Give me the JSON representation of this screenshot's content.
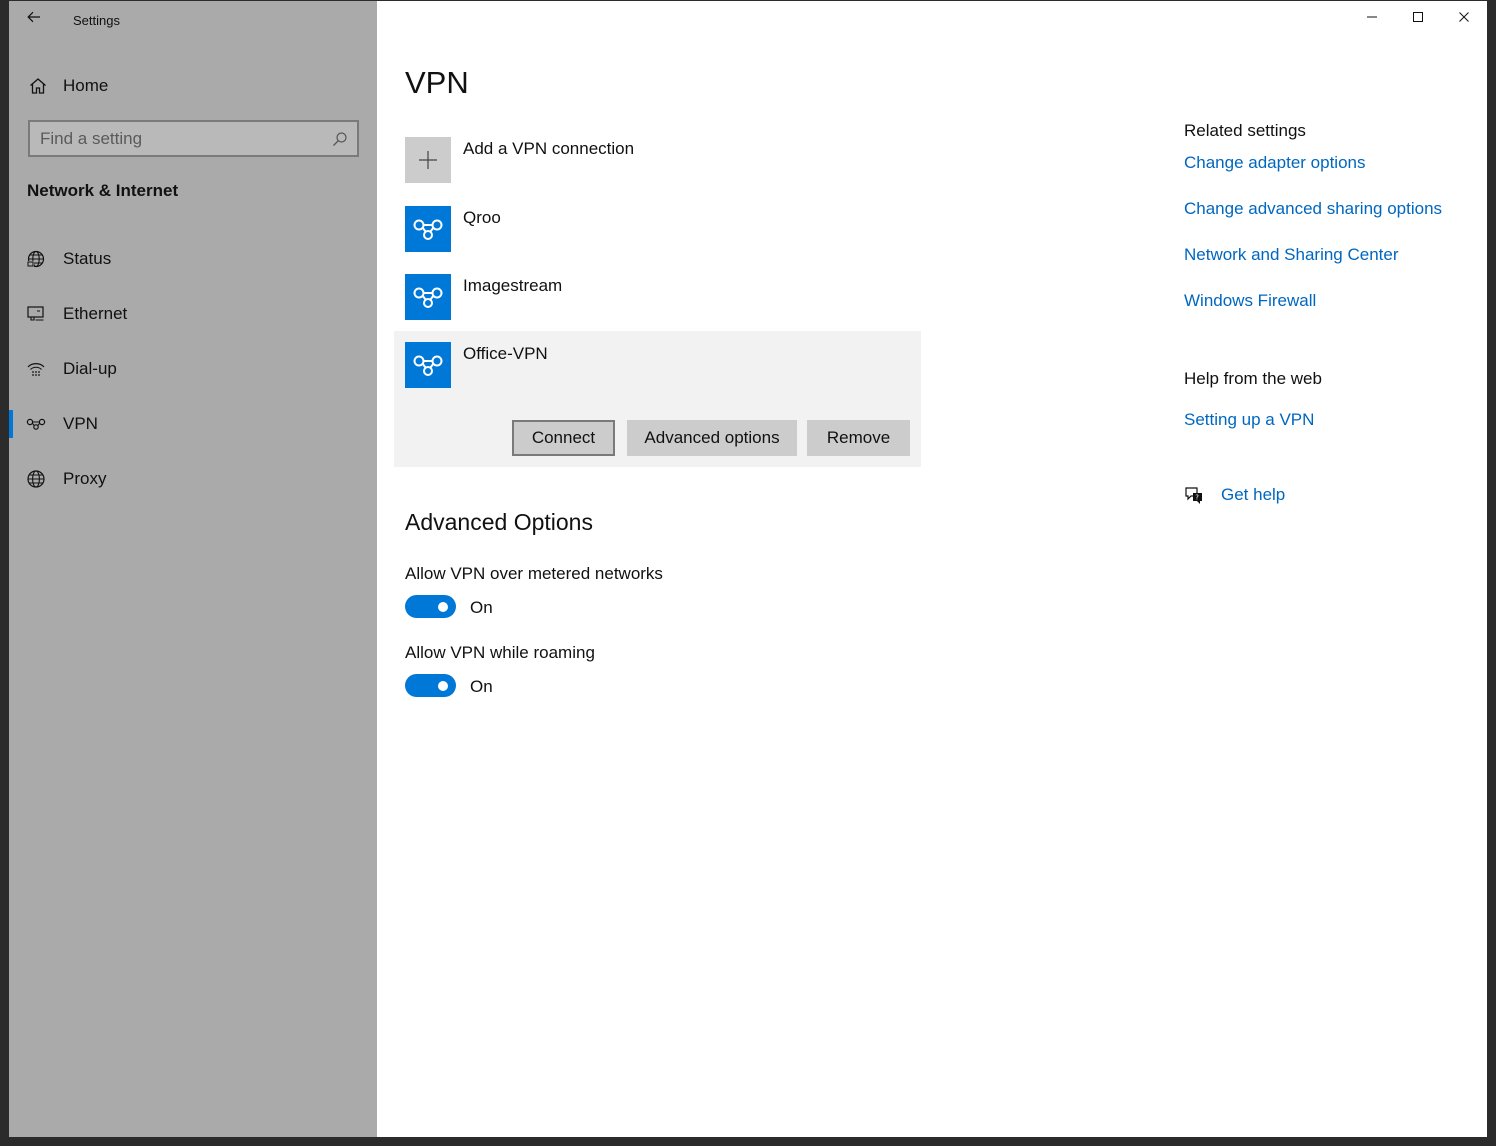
{
  "window": {
    "title": "Settings"
  },
  "sidebar": {
    "home_label": "Home",
    "search_placeholder": "Find a setting",
    "section_title": "Network & Internet",
    "items": [
      {
        "label": "Status",
        "icon": "globe-status-icon",
        "active": false
      },
      {
        "label": "Ethernet",
        "icon": "ethernet-icon",
        "active": false
      },
      {
        "label": "Dial-up",
        "icon": "dialup-icon",
        "active": false
      },
      {
        "label": "VPN",
        "icon": "vpn-icon",
        "active": true
      },
      {
        "label": "Proxy",
        "icon": "globe-icon",
        "active": false
      }
    ]
  },
  "main": {
    "title": "VPN",
    "add_connection_label": "Add a VPN connection",
    "connections": [
      {
        "name": "Qroo"
      },
      {
        "name": "Imagestream"
      },
      {
        "name": "Office-VPN",
        "selected": true
      }
    ],
    "actions": {
      "connect_label": "Connect",
      "advanced_label": "Advanced options",
      "remove_label": "Remove"
    },
    "advanced_title": "Advanced Options",
    "options": [
      {
        "label": "Allow VPN over metered networks",
        "state": "On"
      },
      {
        "label": "Allow VPN while roaming",
        "state": "On"
      }
    ]
  },
  "related": {
    "heading": "Related settings",
    "links": [
      "Change adapter options",
      "Change advanced sharing options",
      "Network and Sharing Center",
      "Windows Firewall"
    ],
    "help_heading": "Help from the web",
    "help_link": "Setting up a VPN",
    "get_help_label": "Get help"
  },
  "colors": {
    "accent": "#0078d7",
    "link": "#0067c0",
    "sidebar_bg": "#aaaaaa"
  }
}
